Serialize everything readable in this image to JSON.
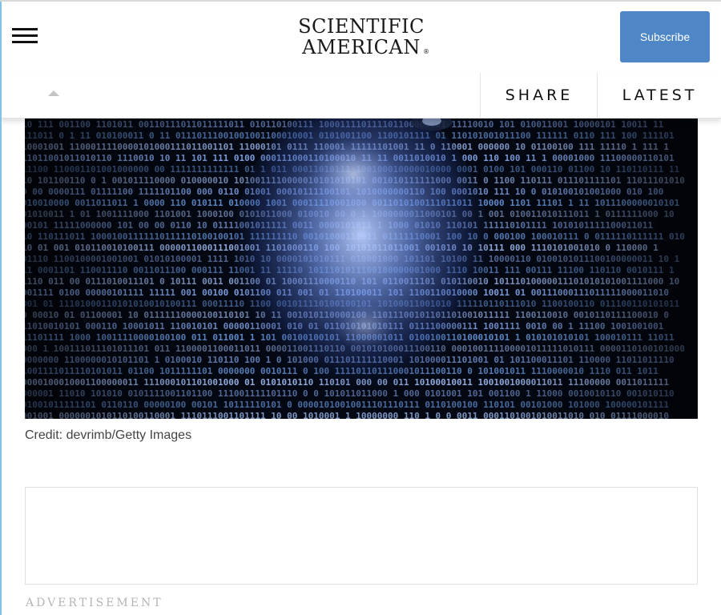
{
  "header": {
    "menu_icon": "hamburger-menu-icon",
    "logo_line1": "SCIENTIFIC",
    "logo_line2": "AMERICAN",
    "logo_mark": "®",
    "subscribe_label": "Subscribe",
    "subscribe_color": "#4f87c6"
  },
  "subbar": {
    "caret_icon": "chevron-up-icon",
    "share_label": "SHARE",
    "latest_label": "LATEST"
  },
  "hero": {
    "credit": "Credit: devrimb/Getty Images"
  },
  "ad": {
    "label": "ADVERTISEMENT"
  }
}
